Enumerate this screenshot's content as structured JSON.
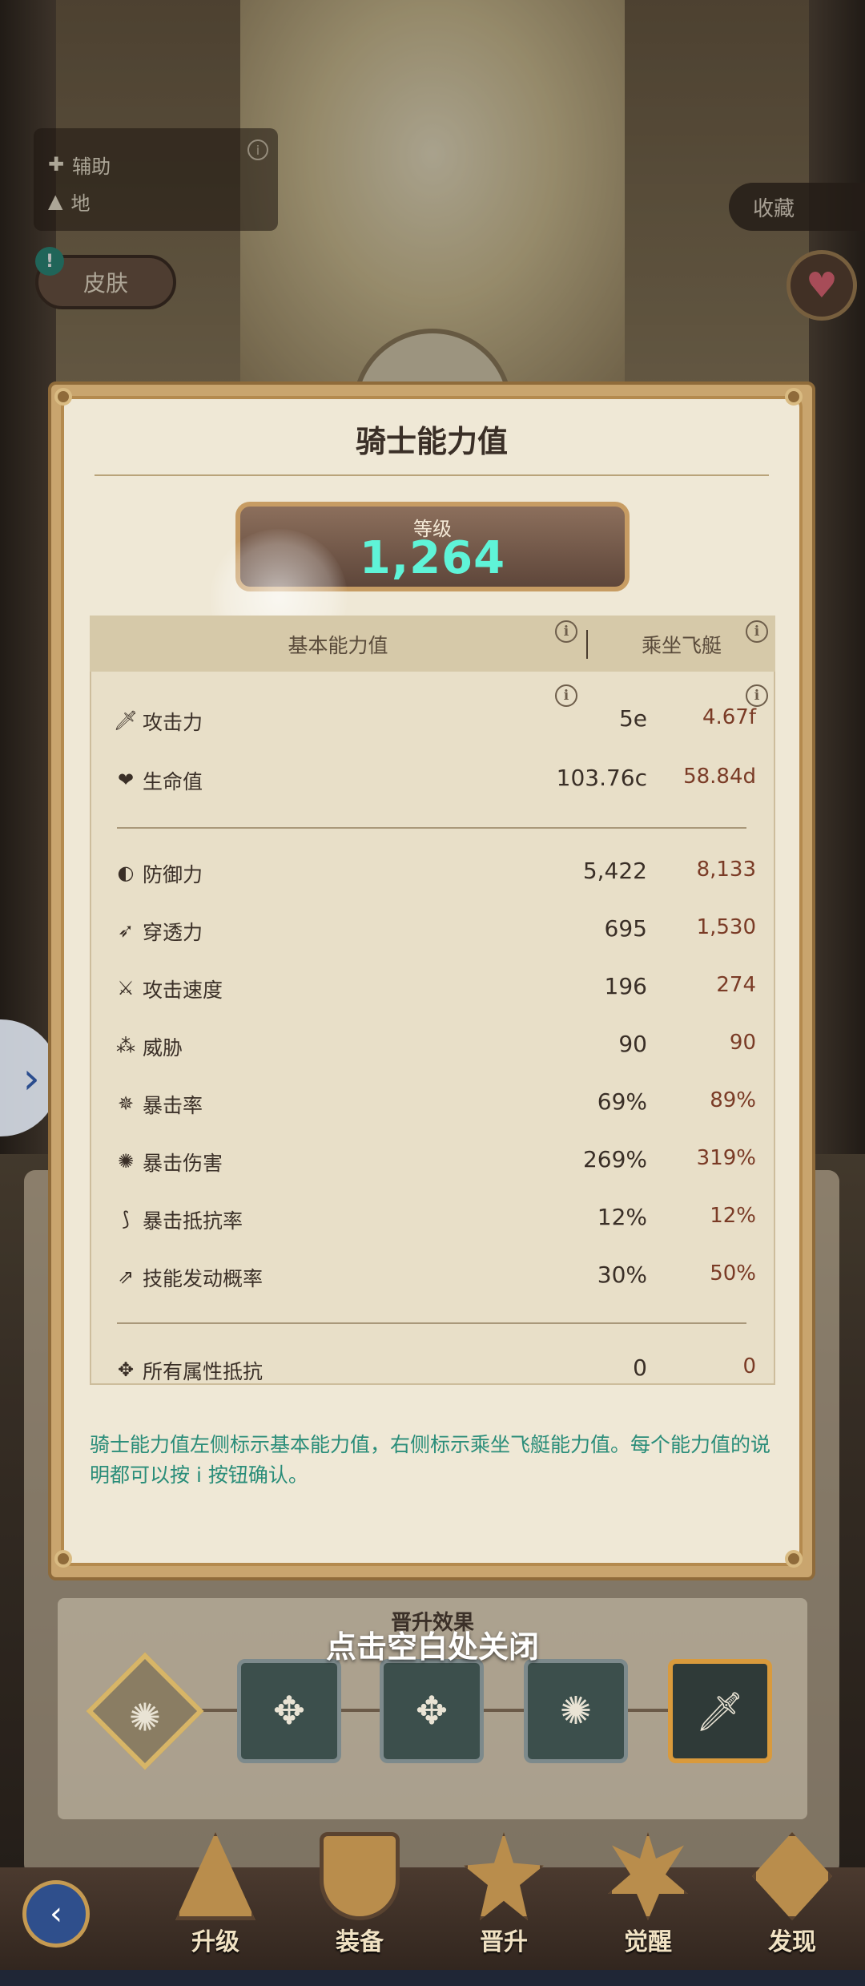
{
  "top_info": {
    "role_label": "辅助",
    "element_label": "地",
    "skin_button": "皮肤",
    "alert_mark": "!",
    "collect_button": "收藏"
  },
  "modal": {
    "title": "骑士能力值",
    "level_label": "等级",
    "level_value": "1,264",
    "col_base": "基本能力值",
    "col_ride": "乘坐飞艇",
    "info_glyph": "i",
    "stats": [
      {
        "icon": "sword-icon",
        "name": "攻击力",
        "base": "5e",
        "ride": "4.67f"
      },
      {
        "icon": "heart-plus-icon",
        "name": "生命值",
        "base": "103.76c",
        "ride": "58.84d"
      },
      {
        "icon": "shield-icon",
        "name": "防御力",
        "base": "5,422",
        "ride": "8,133"
      },
      {
        "icon": "pierce-icon",
        "name": "穿透力",
        "base": "695",
        "ride": "1,530"
      },
      {
        "icon": "speed-sword-icon",
        "name": "攻击速度",
        "base": "196",
        "ride": "274"
      },
      {
        "icon": "threat-icon",
        "name": "威胁",
        "base": "90",
        "ride": "90"
      },
      {
        "icon": "crit-icon",
        "name": "暴击率",
        "base": "69%",
        "ride": "89%"
      },
      {
        "icon": "crit-damage-icon",
        "name": "暴击伤害",
        "base": "269%",
        "ride": "319%"
      },
      {
        "icon": "crit-resist-icon",
        "name": "暴击抵抗率",
        "base": "12%",
        "ride": "12%"
      },
      {
        "icon": "skill-proc-icon",
        "name": "技能发动概率",
        "base": "30%",
        "ride": "50%"
      },
      {
        "icon": "element-resist-icon",
        "name": "所有属性抵抗",
        "base": "0",
        "ride": "0"
      }
    ],
    "note": "骑士能力值左侧标示基本能力值，右侧标示乘坐飞艇能力值。每个能力值的说明都可以按 i 按钮确认。"
  },
  "promotion": {
    "title": "晋升效果",
    "close_hint": "点击空白处关闭",
    "slots": [
      "crit-damage-icon",
      "element-resist-icon",
      "element-resist-icon",
      "crit-damage-icon",
      "sword-icon"
    ]
  },
  "nav": {
    "items": [
      {
        "label": "升级",
        "icon": "triangle-emblem-icon"
      },
      {
        "label": "装备",
        "icon": "shield-emblem-icon"
      },
      {
        "label": "晋升",
        "icon": "star-emblem-icon"
      },
      {
        "label": "觉醒",
        "icon": "burst-emblem-icon"
      },
      {
        "label": "发现",
        "icon": "diamond-star-icon"
      }
    ]
  },
  "colors": {
    "level_value": "#5ff4d8",
    "note_text": "#2a8d79",
    "ride_value": "#7a3b26",
    "modal_border": "#c9a56e"
  }
}
